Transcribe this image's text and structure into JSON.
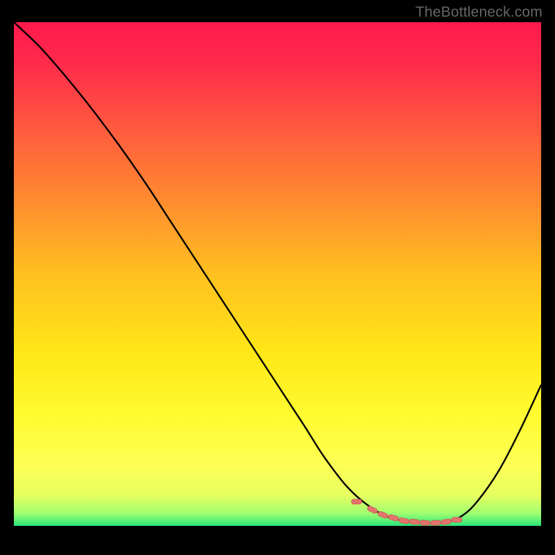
{
  "watermark": "TheBottleneck.com",
  "colors": {
    "gradient_stops": [
      {
        "offset": 0.0,
        "color": "#ff1a4d"
      },
      {
        "offset": 0.08,
        "color": "#ff2a4a"
      },
      {
        "offset": 0.2,
        "color": "#ff5640"
      },
      {
        "offset": 0.35,
        "color": "#ff8a30"
      },
      {
        "offset": 0.5,
        "color": "#ffc020"
      },
      {
        "offset": 0.65,
        "color": "#ffe617"
      },
      {
        "offset": 0.78,
        "color": "#fffb30"
      },
      {
        "offset": 0.88,
        "color": "#fdff55"
      },
      {
        "offset": 0.94,
        "color": "#e6ff60"
      },
      {
        "offset": 0.975,
        "color": "#a0ff70"
      },
      {
        "offset": 1.0,
        "color": "#28e67a"
      }
    ],
    "curve": "#000000",
    "marker_fill": "#e2746d",
    "marker_stroke": "#c85a54"
  },
  "chart_data": {
    "type": "line",
    "title": "",
    "xlabel": "",
    "ylabel": "",
    "xlim": [
      0,
      100
    ],
    "ylim": [
      0,
      100
    ],
    "series": [
      {
        "name": "bottleneck-curve",
        "x": [
          0,
          5,
          10,
          15,
          20,
          25,
          30,
          35,
          40,
          45,
          50,
          55,
          58,
          60,
          63,
          66,
          70,
          74,
          78,
          82,
          85,
          88,
          92,
          96,
          100
        ],
        "y": [
          100,
          95,
          89,
          82.5,
          75.5,
          68,
          60,
          52,
          44,
          36,
          28,
          20,
          15,
          12,
          8,
          5,
          2.2,
          1.0,
          0.6,
          0.8,
          2.0,
          5,
          11,
          19,
          28
        ]
      }
    ],
    "markers": {
      "name": "optimal-range",
      "x": [
        65,
        68,
        70,
        72,
        74,
        76,
        78,
        80,
        82,
        84
      ],
      "y": [
        4.8,
        3.2,
        2.2,
        1.6,
        1.0,
        0.8,
        0.6,
        0.6,
        0.8,
        1.2
      ]
    }
  }
}
